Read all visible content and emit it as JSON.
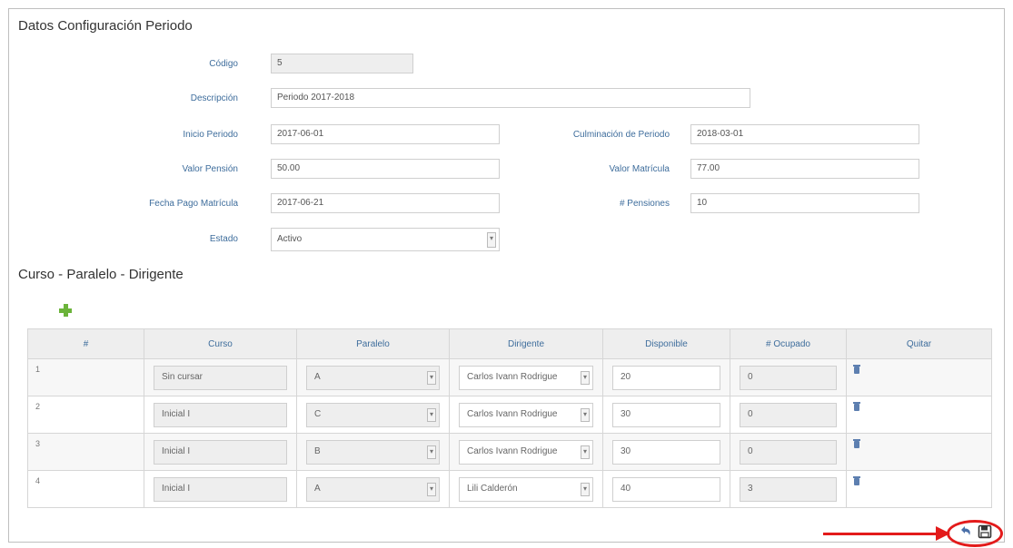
{
  "form": {
    "title": "Datos Configuración Periodo",
    "codigo": {
      "label": "Código",
      "value": "5"
    },
    "descripcion": {
      "label": "Descripción",
      "value": "Periodo 2017-2018"
    },
    "inicio": {
      "label": "Inicio Periodo",
      "value": "2017-06-01"
    },
    "culminacion": {
      "label": "Culminación de Periodo",
      "value": "2018-03-01"
    },
    "pension": {
      "label": "Valor Pensión",
      "value": "50.00"
    },
    "matricula": {
      "label": "Valor Matrícula",
      "value": "77.00"
    },
    "fecha_pago": {
      "label": "Fecha Pago Matrícula",
      "value": "2017-06-21"
    },
    "num_pensiones": {
      "label": "# Pensiones",
      "value": "10"
    },
    "estado": {
      "label": "Estado",
      "value": "Activo"
    }
  },
  "section2": {
    "title": "Curso - Paralelo - Dirigente"
  },
  "table": {
    "headers": [
      "#",
      "Curso",
      "Paralelo",
      "Dirigente",
      "Disponible",
      "# Ocupado",
      "Quitar"
    ],
    "rows": [
      {
        "n": "1",
        "curso": "Sin cursar",
        "paralelo": "A",
        "dirigente": "Carlos Ivann Rodrigue",
        "disponible": "20",
        "ocupado": "0"
      },
      {
        "n": "2",
        "curso": "Inicial I",
        "paralelo": "C",
        "dirigente": "Carlos Ivann Rodrigue",
        "disponible": "30",
        "ocupado": "0"
      },
      {
        "n": "3",
        "curso": "Inicial I",
        "paralelo": "B",
        "dirigente": "Carlos Ivann Rodrigue",
        "disponible": "30",
        "ocupado": "0"
      },
      {
        "n": "4",
        "curso": "Inicial I",
        "paralelo": "A",
        "dirigente": "Lili Calderón",
        "disponible": "40",
        "ocupado": "3"
      }
    ]
  },
  "icons": {
    "add": "plus-icon",
    "remove": "trash-icon",
    "undo": "undo-icon",
    "save": "save-icon"
  },
  "colors": {
    "label": "#3e6d9c",
    "add": "#6bb33a",
    "highlight": "#e31b1b"
  }
}
